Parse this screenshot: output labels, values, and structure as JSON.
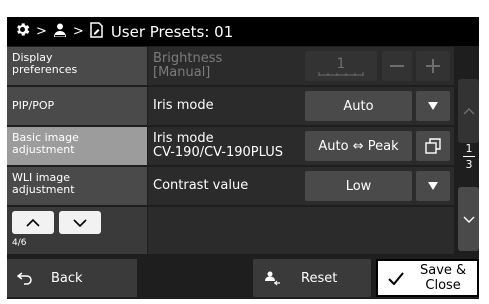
{
  "breadcrumb": {
    "title": "User Presets: 01"
  },
  "sidebar": {
    "items": [
      {
        "label_line1": "Display",
        "label_line2": "preferences",
        "active": false
      },
      {
        "label_line1": "PIP/POP",
        "label_line2": "",
        "active": false
      },
      {
        "label_line1": "Basic image",
        "label_line2": "adjustment",
        "active": true
      },
      {
        "label_line1": "WLI image",
        "label_line2": "adjustment",
        "active": false
      }
    ],
    "page_indicator": "4/6"
  },
  "rows": [
    {
      "label_line1": "Brightness",
      "label_line2": "[Manual]",
      "value": "1",
      "enabled": false
    },
    {
      "label_line1": "Iris mode",
      "label_line2": "",
      "value": "Auto",
      "enabled": true
    },
    {
      "label_line1": "Iris mode",
      "label_line2": "CV-190/CV-190PLUS",
      "value": "Auto ⇔ Peak",
      "enabled": true
    },
    {
      "label_line1": "Contrast value",
      "label_line2": "",
      "value": "Low",
      "enabled": true
    }
  ],
  "pager": {
    "current": "1",
    "total": "3"
  },
  "bottom": {
    "back_label": "Back",
    "reset_label": "Reset",
    "save_label_line1": "Save &",
    "save_label_line2": "Close"
  },
  "icons": {
    "settings": "gear-icon",
    "user": "user-icon",
    "preset": "preset-icon",
    "back": "back-arrow-icon",
    "reset": "user-reset-icon",
    "save": "checkmark-icon"
  },
  "colors": {
    "background": "#1e1e1e",
    "active": "#9c9c9c",
    "dim_text": "#7c7c7c"
  }
}
